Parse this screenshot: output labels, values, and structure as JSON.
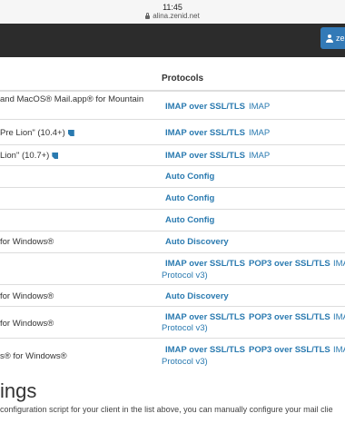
{
  "browser": {
    "time": "11:45",
    "url": "alina.zenid.net"
  },
  "navbar": {
    "user_button_label": "ze"
  },
  "table": {
    "header_protocols": "Protocols",
    "rows": [
      {
        "client_line1": "and MacOS® Mail.app® for Mountain",
        "client_line2": "",
        "p1": "IMAP over SSL/TLS",
        "p2": "IMAP"
      },
      {
        "client_line1": "Pre Lion\" (10.4+)",
        "p1": "IMAP over SSL/TLS",
        "p2": "IMAP"
      },
      {
        "client_line1": "Lion\" (10.7+)",
        "p1": "IMAP over SSL/TLS",
        "p2": "IMAP"
      },
      {
        "client_line1": "",
        "p1": "Auto Config"
      },
      {
        "client_line1": "",
        "p1": "Auto Config"
      },
      {
        "client_line1": "",
        "p1": "Auto Config"
      },
      {
        "client_line1": "for Windows®",
        "p1": "Auto Discovery"
      },
      {
        "client_line1": "",
        "p1": "IMAP over SSL/TLS",
        "p2": "POP3 over SSL/TLS",
        "p3": "IMAP",
        "cont": "Protocol v3)"
      },
      {
        "client_line1": "for Windows®",
        "p1": "Auto Discovery"
      },
      {
        "client_line1": "for Windows®",
        "p1": "IMAP over SSL/TLS",
        "p2": "POP3 over SSL/TLS",
        "p3": "IMA",
        "cont": "Protocol v3)"
      },
      {
        "client_line1": "s® for Windows®",
        "p1": "IMAP over SSL/TLS",
        "p2": "POP3 over SSL/TLS",
        "p3": "IMA",
        "cont": "Protocol v3)"
      }
    ]
  },
  "manual": {
    "title": "ings",
    "text": "configuration script for your client in the list above, you can manually configure your mail clie"
  }
}
